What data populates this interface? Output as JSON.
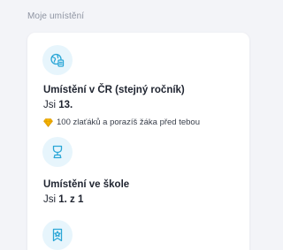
{
  "section_title": "Moje umístění",
  "items": [
    {
      "icon": "globe-document-icon",
      "title": "Umístění v ČR (stejný ročník)",
      "value_prefix": "Jsi ",
      "value": "13.",
      "reward_text": "100 zlaťáků a porazíš žáka před tebou",
      "reward_icon": "diamond-icon"
    },
    {
      "icon": "trophy-icon",
      "title": "Umístění ve škole",
      "value_prefix": "Jsi ",
      "value": "1. z 1"
    },
    {
      "icon": "ribbon-badge-icon"
    }
  ],
  "colors": {
    "icon_bg": "#e7f5fc",
    "icon_stroke": "#2aa6d6",
    "reward_gem": "#f5b400"
  }
}
